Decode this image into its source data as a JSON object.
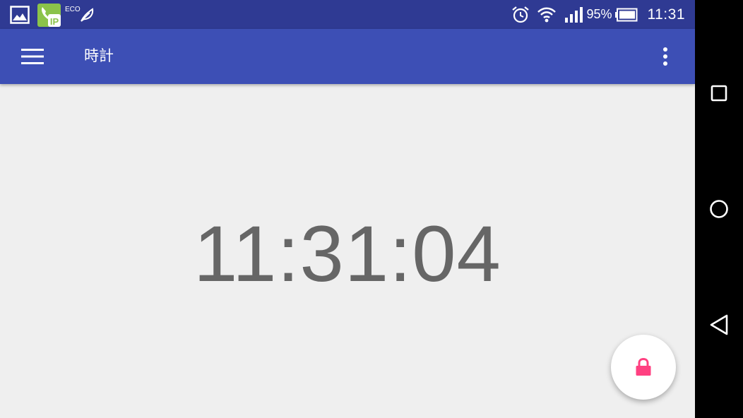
{
  "status_bar": {
    "left_icons": [
      "image-notification-icon",
      "ip-phone-app-icon",
      "eco-leaf-icon"
    ],
    "eco_label": "ECO",
    "right_icons": [
      "alarm-icon",
      "wifi-icon",
      "signal-icon",
      "battery-icon"
    ],
    "battery_percent": "95%",
    "time": "11:31",
    "bg_color": "#2f3a93"
  },
  "app_bar": {
    "title": "時計",
    "menu_icon": "hamburger-menu-icon",
    "overflow_icon": "more-vert-icon",
    "bg_color": "#3d4fb5"
  },
  "main": {
    "clock_time": "11:31:04",
    "clock_color": "#666666",
    "bg_color": "#efefef"
  },
  "fab": {
    "icon": "lock-icon",
    "icon_color": "#ff4081"
  },
  "nav_bar": {
    "buttons": [
      "recent-apps-icon",
      "home-icon",
      "back-icon"
    ]
  }
}
